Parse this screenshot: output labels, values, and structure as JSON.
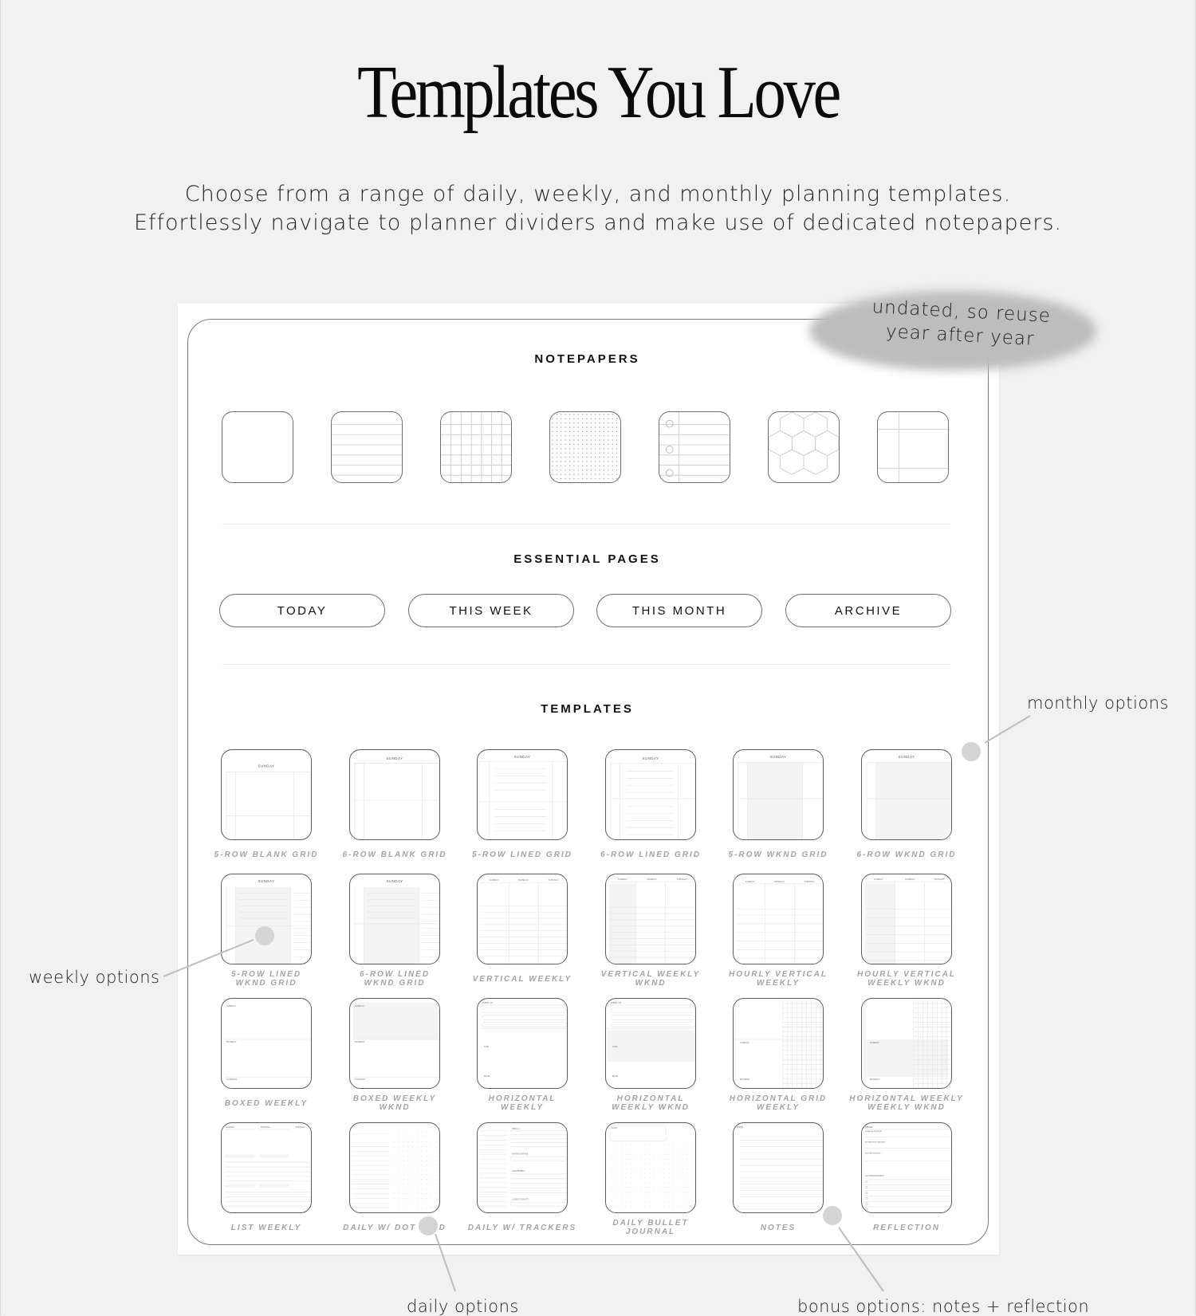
{
  "hero": {
    "title": "Templates You Love",
    "subtitle_lines": [
      "Choose from a range of daily, weekly, and monthly planning templates.",
      "Effortlessly navigate to planner dividers and make use of dedicated notepapers."
    ]
  },
  "badge": {
    "lines": [
      "undated, so reuse",
      "year after year"
    ]
  },
  "sections": {
    "notepapers": {
      "title": "NOTEPAPERS",
      "items": [
        {
          "name": "blank",
          "icon": "blank-paper-icon"
        },
        {
          "name": "lined",
          "icon": "lined-paper-icon"
        },
        {
          "name": "grid",
          "icon": "grid-paper-icon"
        },
        {
          "name": "dot-grid",
          "icon": "dot-grid-paper-icon"
        },
        {
          "name": "ruled-with-holes",
          "icon": "ruled-holes-paper-icon"
        },
        {
          "name": "hexagon",
          "icon": "hexagon-paper-icon"
        },
        {
          "name": "cornell",
          "icon": "cornell-paper-icon"
        }
      ]
    },
    "essential": {
      "title": "ESSENTIAL PAGES",
      "buttons": [
        "TODAY",
        "THIS WEEK",
        "THIS MONTH",
        "ARCHIVE"
      ]
    },
    "templates": {
      "title": "TEMPLATES",
      "header_word": "SUNDAY",
      "rows": [
        [
          "5-ROW BLANK GRID",
          "6-ROW BLANK GRID",
          "5-ROW LINED GRID",
          "6-ROW LINED GRID",
          "5-ROW WKND GRID",
          "6-ROW WKND GRID"
        ],
        [
          "5-ROW LINED\nWKND GRID",
          "6-ROW LINED\nWKND GRID",
          "VERTICAL WEEKLY",
          "VERTICAL WEEKLY\nWKND",
          "HOURLY VERTICAL\nWEEKLY",
          "HOURLY VERTICAL\nWEEKLY WKND"
        ],
        [
          "BOXED WEEKLY",
          "BOXED WEEKLY\nWKND",
          "HORIZONTAL\nWEEKLY",
          "HORIZONTAL\nWEEKLY WKND",
          "HORIZONTAL GRID\nWEEKLY",
          "HORIZONTAL WEEKLY\nWEEKLY WKND"
        ],
        [
          "LIST WEEKLY",
          "DAILY W/ DOT GRID",
          "DAILY W/ TRACKERS",
          "DAILY BULLET\nJOURNAL",
          "NOTES",
          "REFLECTION"
        ]
      ]
    }
  },
  "callouts": {
    "monthly": "monthly options",
    "weekly": "weekly options",
    "daily": "daily options",
    "bonus": "bonus options: notes + reflection"
  }
}
